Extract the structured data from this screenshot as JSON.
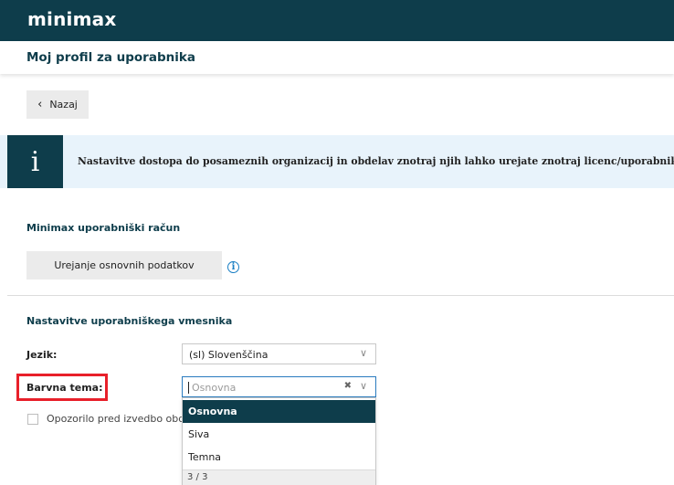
{
  "app": {
    "logo": "minimax"
  },
  "header": {
    "title": "Moj profil za uporabnika"
  },
  "back_button": {
    "label": "Nazaj",
    "icon": "chevron-left-icon"
  },
  "info_banner": {
    "icon": "info-icon",
    "glyph": "i",
    "text": "Nastavitve dostopa do posameznih organizacij in obdelav znotraj njih lahko urejate znotraj licenc/uporabnikov."
  },
  "account_section": {
    "title": "Minimax uporabniški račun",
    "edit_button": "Urejanje osnovnih podatkov",
    "help_icon": "info-circle-icon"
  },
  "ui_settings": {
    "title": "Nastavitve uporabniškega vmesnika",
    "language_label": "Jezik:",
    "language_value": "(sl) Slovenščina",
    "theme_label": "Barvna tema:",
    "theme_placeholder": "Osnovna",
    "theme_options": [
      {
        "label": "Osnovna",
        "selected": true
      },
      {
        "label": "Siva",
        "selected": false
      },
      {
        "label": "Temna",
        "selected": false
      }
    ],
    "theme_count": "3 / 3",
    "warning_checkbox_label": "Opozorilo pred izvedbo obd"
  },
  "colors": {
    "brand_dark": "#0e3d4b",
    "highlight_red": "#e8202a",
    "info_bg": "#e8f3fb",
    "link_blue": "#1a7fc4"
  }
}
